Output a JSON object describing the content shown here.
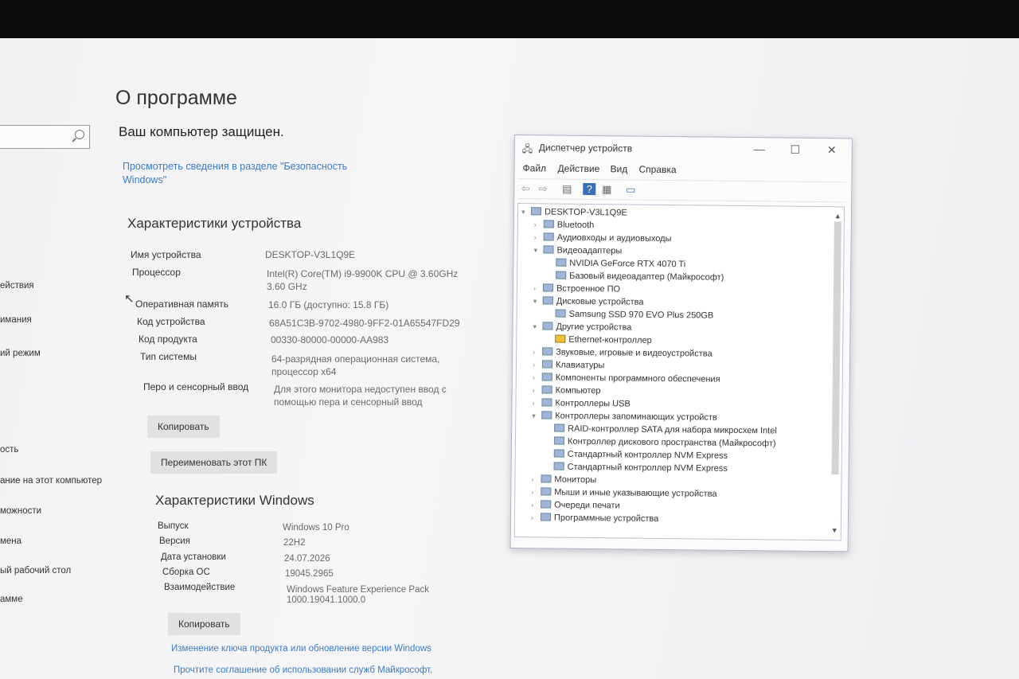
{
  "page": {
    "title": "О программе",
    "protected_text": "Ваш компьютер защищен.",
    "security_link": "Просмотреть сведения в разделе \"Безопасность\nWindows\""
  },
  "sidebar": {
    "items": [
      "ействия",
      "имания",
      "ий режим",
      "ость",
      "ание на этот компьютер",
      "можности",
      "мена",
      "ый рабочий стол",
      "амме"
    ]
  },
  "device_specs": {
    "heading": "Характеристики устройства",
    "rows": [
      {
        "label": "Имя устройства",
        "value": "DESKTOP-V3L1Q9E"
      },
      {
        "label": "Процессор",
        "value": "Intel(R) Core(TM) i9-9900K CPU @ 3.60GHz\n3.60 GHz"
      },
      {
        "label": "Оперативная память",
        "value": "16.0 ГБ (доступно: 15.8 ГБ)"
      },
      {
        "label": "Код устройства",
        "value": "68A51C3B-9702-4980-9FF2-01A65547FD29"
      },
      {
        "label": "Код продукта",
        "value": "00330-80000-00000-AA983"
      },
      {
        "label": "Тип системы",
        "value": "64-разрядная операционная система,\nпроцессор x64"
      },
      {
        "label": "Перо и сенсорный ввод",
        "value": "Для этого монитора недоступен ввод с\nпомощью пера и сенсорный ввод"
      }
    ],
    "copy_button": "Копировать",
    "rename_button": "Переименовать этот ПК"
  },
  "windows_specs": {
    "heading": "Характеристики Windows",
    "rows": [
      {
        "label": "Выпуск",
        "value": "Windows 10 Pro"
      },
      {
        "label": "Версия",
        "value": "22H2"
      },
      {
        "label": "Дата установки",
        "value": "24.07.2026"
      },
      {
        "label": "Сборка ОС",
        "value": "19045.2965"
      },
      {
        "label": "Взаимодействие",
        "value": "Windows Feature Experience Pack\n1000.19041.1000.0"
      }
    ],
    "copy_button": "Копировать",
    "link_change_key": "Изменение ключа продукта или обновление версии Windows",
    "link_agreement": "Прочтите соглашение об использовании служб Майкрософт,"
  },
  "device_manager": {
    "title": "Диспетчер устройств",
    "window_buttons": {
      "minimize": "—",
      "maximize": "☐",
      "close": "✕"
    },
    "menu": [
      "Файл",
      "Действие",
      "Вид",
      "Справка"
    ],
    "tree": [
      {
        "level": 0,
        "expanded": true,
        "label": "DESKTOP-V3L1Q9E"
      },
      {
        "level": 1,
        "expanded": false,
        "label": "Bluetooth"
      },
      {
        "level": 1,
        "expanded": false,
        "label": "Аудиовходы и аудиовыходы"
      },
      {
        "level": 1,
        "expanded": true,
        "label": "Видеоадаптеры"
      },
      {
        "level": 2,
        "label": "NVIDIA GeForce RTX 4070 Ti"
      },
      {
        "level": 2,
        "label": "Базовый видеоадаптер (Майкрософт)"
      },
      {
        "level": 1,
        "expanded": false,
        "label": "Встроенное ПО"
      },
      {
        "level": 1,
        "expanded": true,
        "label": "Дисковые устройства"
      },
      {
        "level": 2,
        "label": "Samsung SSD 970 EVO Plus 250GB"
      },
      {
        "level": 1,
        "expanded": true,
        "label": "Другие устройства"
      },
      {
        "level": 2,
        "warn": true,
        "label": "Ethernet-контроллер"
      },
      {
        "level": 1,
        "expanded": false,
        "label": "Звуковые, игровые и видеоустройства"
      },
      {
        "level": 1,
        "expanded": false,
        "label": "Клавиатуры"
      },
      {
        "level": 1,
        "expanded": false,
        "label": "Компоненты программного обеспечения"
      },
      {
        "level": 1,
        "expanded": false,
        "label": "Компьютер"
      },
      {
        "level": 1,
        "expanded": false,
        "label": "Контроллеры USB"
      },
      {
        "level": 1,
        "expanded": true,
        "label": "Контроллеры запоминающих устройств"
      },
      {
        "level": 2,
        "label": "RAID-контроллер SATA для набора микросхем Intel"
      },
      {
        "level": 2,
        "label": "Контроллер дискового пространства (Майкрософт)"
      },
      {
        "level": 2,
        "label": "Стандартный контроллер NVM Express"
      },
      {
        "level": 2,
        "label": "Стандартный контроллер NVM Express"
      },
      {
        "level": 1,
        "expanded": false,
        "label": "Мониторы"
      },
      {
        "level": 1,
        "expanded": false,
        "label": "Мыши и иные указывающие устройства"
      },
      {
        "level": 1,
        "expanded": false,
        "label": "Очереди печати"
      },
      {
        "level": 1,
        "expanded": false,
        "label": "Программные устройства"
      }
    ]
  }
}
